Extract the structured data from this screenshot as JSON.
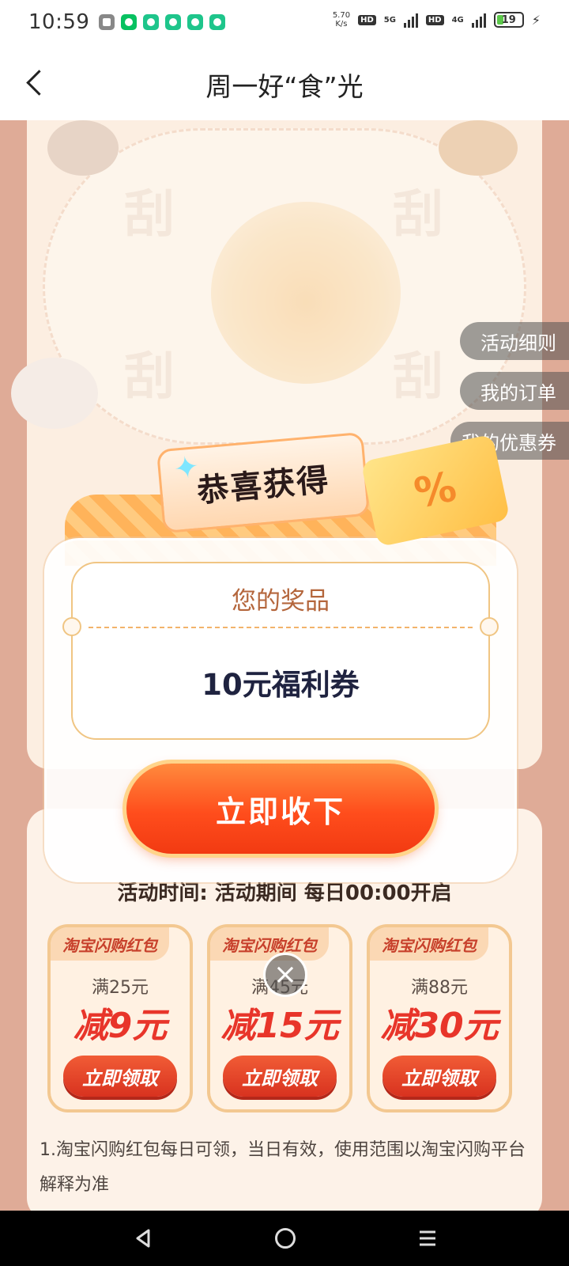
{
  "status_bar": {
    "time": "10:59",
    "net_speed_value": "5.70",
    "net_speed_unit": "K/s",
    "hd1": "HD",
    "sig1": "5G",
    "hd2": "HD",
    "sig2": "4G",
    "battery": "19"
  },
  "header": {
    "title": "周一好“食”光"
  },
  "side_tabs": [
    "活动细则",
    "我的订单",
    "我的优惠券"
  ],
  "modal": {
    "banner": "恭喜获得",
    "ticket_symbol": "%",
    "prize_label": "您的奖品",
    "prize_value": "10元福利券",
    "accept_button": "立即收下"
  },
  "activity": {
    "time_text": "活动时间: 活动期间 每日00:00开启",
    "packets": [
      {
        "header": "淘宝闪购红包",
        "condition": "满25元",
        "discount": "减9元",
        "button": "立即领取"
      },
      {
        "header": "淘宝闪购红包",
        "condition": "满45元",
        "discount": "减15元",
        "button": "立即领取"
      },
      {
        "header": "淘宝闪购红包",
        "condition": "满88元",
        "discount": "减30元",
        "button": "立即领取"
      }
    ],
    "rules": "1.淘宝闪购红包每日可领，当日有效，使用范围以淘宝闪购平台解释为准"
  },
  "colors": {
    "accent": "#ff4d1c",
    "page_bg": "#b8461a",
    "prize_text": "#1f2340"
  }
}
